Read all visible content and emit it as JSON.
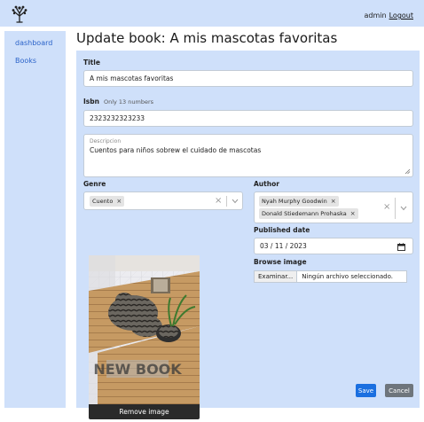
{
  "header": {
    "logo_icon": "tree-icon",
    "username": "admin",
    "logout_label": "Logout"
  },
  "sidebar": {
    "items": [
      {
        "label": "dashboard"
      },
      {
        "label": "Books"
      }
    ]
  },
  "page": {
    "title": "Update book: A mis mascotas favoritas"
  },
  "form": {
    "title_label": "Title",
    "title_value": "A mis mascotas favoritas",
    "isbn_label": "Isbn",
    "isbn_hint": "Only 13 numbers",
    "isbn_value": "2323232323233",
    "description_placeholder": "Descripcion",
    "description_value": "Cuentos para niños sobrew el cuidado de mascotas",
    "genre_label": "Genre",
    "genre_selected": [
      {
        "label": "Cuento"
      }
    ],
    "author_label": "Author",
    "author_selected": [
      {
        "label": "Nyah Murphy Goodwin"
      },
      {
        "label": "Donald Stiedemann Prohaska"
      }
    ],
    "published_label": "Published date",
    "published_value": "03 / 11 / 2023",
    "browse_label": "Browse image",
    "browse_button": "Examinar...",
    "browse_file": "Ningún archivo seleccionado.",
    "image_watermark": "NEW BOOK",
    "remove_image_label": "Remove image",
    "save_label": "Save",
    "cancel_label": "Cancel"
  },
  "colors": {
    "panel": "#cfe0fa",
    "primary": "#1a6fe0",
    "secondary": "#6e757c",
    "link": "#2b63c9"
  }
}
